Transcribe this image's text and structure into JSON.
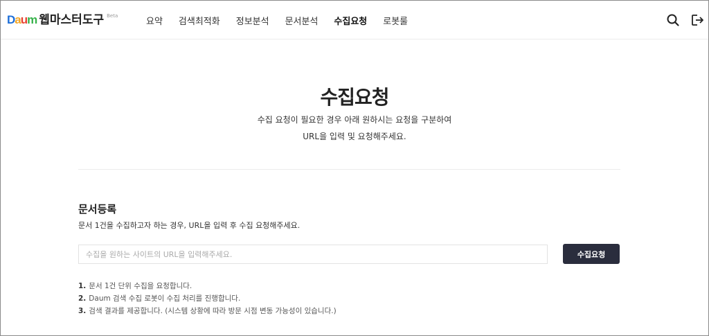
{
  "header": {
    "logo": {
      "letters": [
        "D",
        "a",
        "u",
        "m"
      ],
      "colors": [
        "#1e6fd9",
        "#f5a623",
        "#e8412f",
        "#36b24a"
      ]
    },
    "title": "웹마스터도구",
    "beta": "Beta",
    "nav": [
      "요약",
      "검색최적화",
      "정보분석",
      "문서분석",
      "수집요청",
      "로봇룰"
    ],
    "active_nav": "수집요청",
    "icons": [
      "search-icon",
      "logout-icon"
    ]
  },
  "hero": {
    "title": "수집요청",
    "desc_line1": "수집 요청이 필요한 경우 아래 원하시는 요청을 구분하여",
    "desc_line2": "URL을 입력 및 요청해주세요."
  },
  "doc_register": {
    "title": "문서등록",
    "desc": "문서 1건을 수집하고자 하는 경우, URL을 입력 후 수집 요청해주세요.",
    "input_placeholder": "수집을 원하는 사이트의 URL을 입력해주세요.",
    "input_value": "",
    "button_label": "수집요청",
    "button_color": "#2a2d3d"
  },
  "notes": [
    {
      "num": "1.",
      "text": "문서 1건 단위 수집을 요청합니다."
    },
    {
      "num": "2.",
      "text": "Daum 검색 수집 로봇이 수집 처리를 진행합니다."
    },
    {
      "num": "3.",
      "text": "검색 결과를 제공합니다. (시스템 상황에 따라 방문 시점 변동 가능성이 있습니다.)"
    }
  ]
}
